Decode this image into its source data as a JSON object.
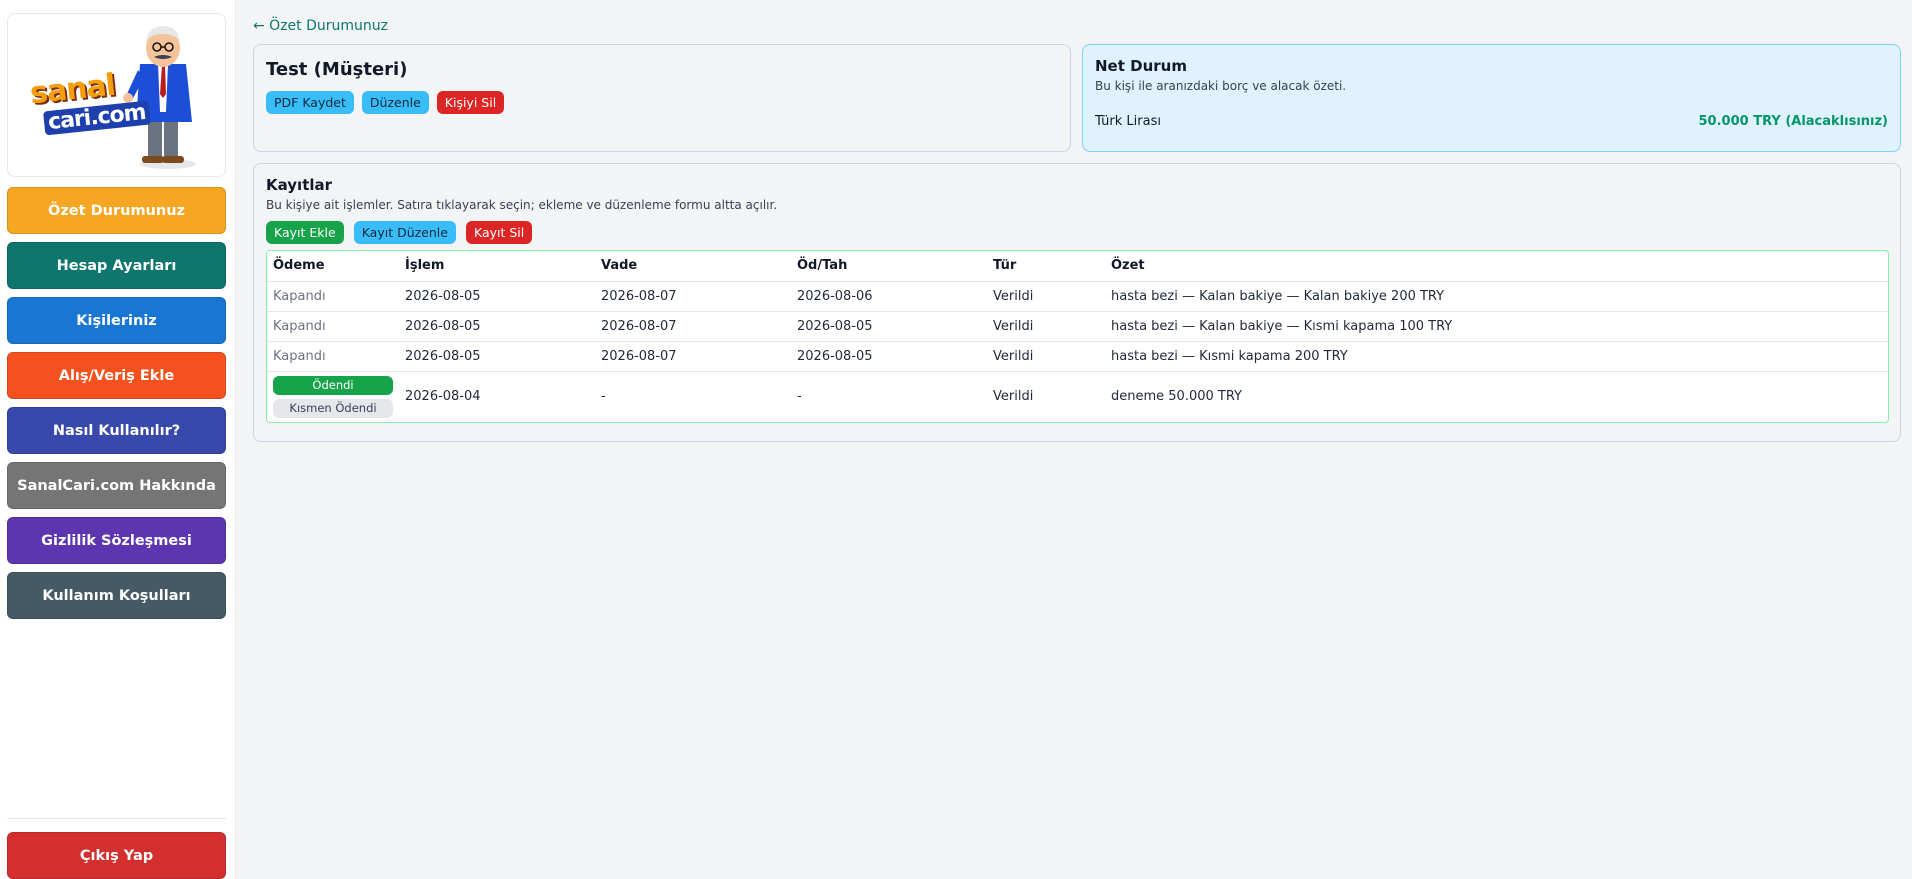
{
  "sidebar": {
    "logo_text": "sanalcari.com",
    "items": [
      {
        "label": "Özet Durumunuz",
        "color": "#f5a623"
      },
      {
        "label": "Hesap Ayarları",
        "color": "#0f766e"
      },
      {
        "label": "Kişileriniz",
        "color": "#1976d2"
      },
      {
        "label": "Alış/Veriş Ekle",
        "color": "#f4511e"
      },
      {
        "label": "Nasıl Kullanılır?",
        "color": "#3949ab"
      },
      {
        "label": "SanalCari.com Hakkında",
        "color": "#757575"
      },
      {
        "label": "Gizlilik Sözleşmesi",
        "color": "#5e35b1"
      },
      {
        "label": "Kullanım Koşulları",
        "color": "#455a64"
      }
    ],
    "logout": {
      "label": "Çıkış Yap",
      "color": "#d32f2f"
    }
  },
  "back_link": "← Özet Durumunuz",
  "person": {
    "title": "Test (Müşteri)",
    "buttons": {
      "pdf": "PDF Kaydet",
      "edit": "Düzenle",
      "delete": "Kişiyi Sil"
    }
  },
  "net": {
    "title": "Net Durum",
    "subtitle": "Bu kişi ile aranızdaki borç ve alacak özeti.",
    "currency": "Türk Lirası",
    "value": "50.000 TRY (Alacaklısınız)"
  },
  "records": {
    "title": "Kayıtlar",
    "subtitle": "Bu kişiye ait işlemler. Satıra tıklayarak seçin; ekleme ve düzenleme formu altta açılır.",
    "buttons": {
      "add": "Kayıt Ekle",
      "edit": "Kayıt Düzenle",
      "delete": "Kayıt Sil"
    },
    "columns": [
      "Ödeme",
      "İşlem",
      "Vade",
      "Öd/Tah",
      "Tür",
      "Özet"
    ],
    "rows": [
      {
        "odeme": "Kapandı",
        "islem": "2026-08-05",
        "vade": "2026-08-07",
        "odtah": "2026-08-06",
        "tur": "Verildi",
        "ozet": "hasta bezi — Kalan bakiye — Kalan bakiye 200 TRY"
      },
      {
        "odeme": "Kapandı",
        "islem": "2026-08-05",
        "vade": "2026-08-07",
        "odtah": "2026-08-05",
        "tur": "Verildi",
        "ozet": "hasta bezi — Kalan bakiye — Kısmi kapama 100 TRY"
      },
      {
        "odeme": "Kapandı",
        "islem": "2026-08-05",
        "vade": "2026-08-07",
        "odtah": "2026-08-05",
        "tur": "Verildi",
        "ozet": "hasta bezi — Kısmi kapama 200 TRY"
      },
      {
        "odeme_pills": [
          "Ödendi",
          "Kısmen Ödendi"
        ],
        "islem": "2026-08-04",
        "vade": "-",
        "odtah": "-",
        "tur": "Verildi",
        "ozet": "deneme 50.000 TRY"
      }
    ]
  }
}
